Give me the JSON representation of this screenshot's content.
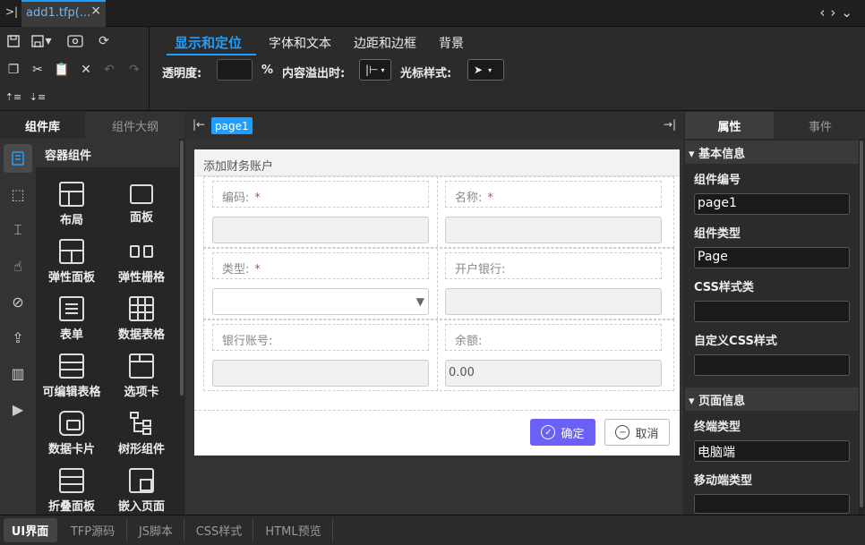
{
  "editor_tab": {
    "title": "add1.tfp(...",
    "close": "×"
  },
  "prop_tabs": [
    "显示和定位",
    "字体和文本",
    "边距和边框",
    "背景"
  ],
  "toolbar2": {
    "opacity_label": "透明度:",
    "percent": "%",
    "overflow_label": "内容溢出时:",
    "cursor_label": "光标样式:"
  },
  "left_tabs": [
    "组件库",
    "组件大纲"
  ],
  "component_group": "容器组件",
  "components": [
    "布局",
    "面板",
    "弹性面板",
    "弹性栅格",
    "表单",
    "数据表格",
    "可编辑表格",
    "选项卡",
    "数据卡片",
    "树形组件",
    "折叠面板",
    "嵌入页面"
  ],
  "page_chip": "page1",
  "form": {
    "title": "添加财务账户",
    "fields": {
      "code": "编码:",
      "name": "名称:",
      "type": "类型:",
      "bank": "开户银行:",
      "account": "银行账号:",
      "balance": "余额:"
    },
    "required_mark": "*",
    "balance_value": "0.00",
    "ok": "确定",
    "cancel": "取消"
  },
  "right_tabs": [
    "属性",
    "事件"
  ],
  "props": {
    "basic_section": "基本信息",
    "id_label": "组件编号",
    "id_value": "page1",
    "type_label": "组件类型",
    "type_value": "Page",
    "css_label": "CSS样式类",
    "css_value": "",
    "custom_css_label": "自定义CSS样式",
    "custom_css_value": "",
    "page_section": "页面信息",
    "terminal_label": "终端类型",
    "terminal_value": "电脑端",
    "mobile_label": "移动端类型",
    "mobile_value": ""
  },
  "bottom_tabs": [
    "UI界面",
    "TFP源码",
    "JS脚本",
    "CSS样式",
    "HTML预览"
  ],
  "colors": {
    "accent": "#1e9fff",
    "ok_button": "#6a61f4",
    "required": "#e54040"
  }
}
